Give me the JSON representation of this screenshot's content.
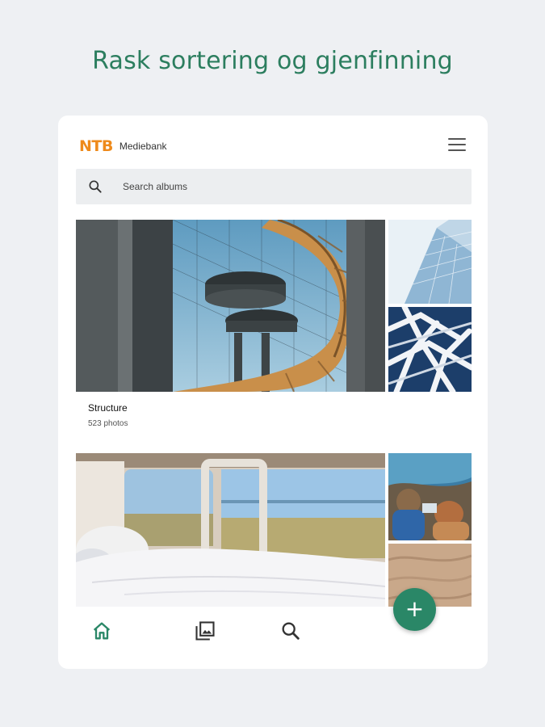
{
  "headline": "Rask sortering og gjenfinning",
  "app": {
    "logo": "NTB",
    "product": "Mediebank"
  },
  "header": {
    "menu_icon": "hamburger-menu-icon"
  },
  "search": {
    "placeholder": "Search albums",
    "value": "",
    "icon": "search-icon"
  },
  "albums": [
    {
      "title": "Structure",
      "count": "523 photos"
    },
    {
      "title": "",
      "count": ""
    }
  ],
  "bottom_nav": [
    {
      "icon": "home-icon",
      "active": true
    },
    {
      "icon": "gallery-icon",
      "active": false
    },
    {
      "icon": "search-icon",
      "active": false
    }
  ],
  "fab": {
    "label": "+"
  },
  "colors": {
    "brand_green": "#2a8767",
    "logo_orange": "#ee8a1b",
    "background": "#eef0f3"
  }
}
